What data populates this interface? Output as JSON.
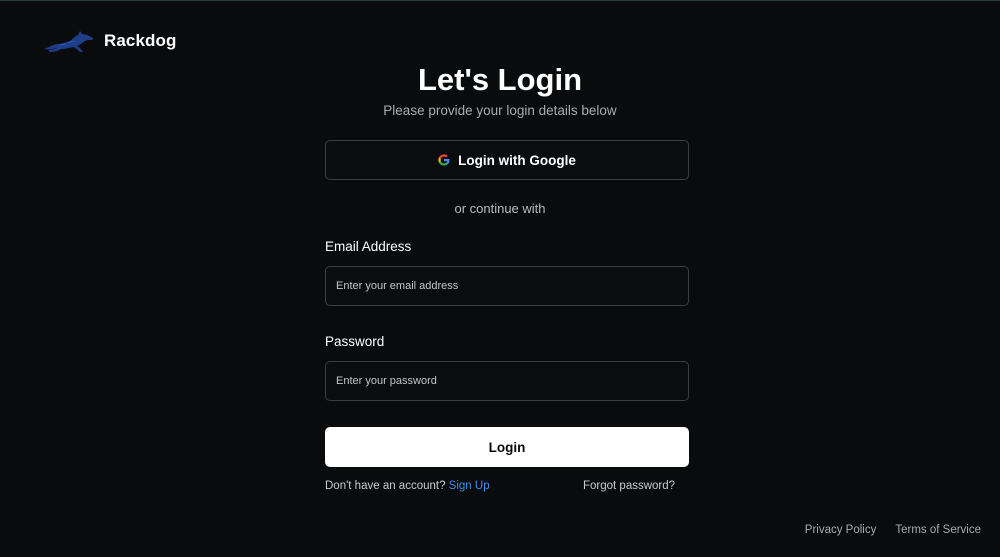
{
  "brand": {
    "name": "Rackdog",
    "logo_icon": "running-dog-icon",
    "logo_color": "#1f3e8a"
  },
  "login": {
    "title": "Let's Login",
    "subtitle": "Please provide your login details below",
    "google_button_label": "Login with Google",
    "google_icon": "google-icon",
    "divider_text": "or continue with",
    "email_label": "Email Address",
    "email_placeholder": "Enter your email address",
    "email_value": "",
    "password_label": "Password",
    "password_placeholder": "Enter your password",
    "password_value": "",
    "submit_label": "Login",
    "signup_prompt": "Don't have an account?",
    "signup_link": "Sign Up",
    "forgot_link": "Forgot password?"
  },
  "footer": {
    "privacy": "Privacy Policy",
    "terms": "Terms of Service"
  },
  "colors": {
    "background": "#0a0b0c",
    "accent_link": "#3d8ff0",
    "primary_button": "#ffffff",
    "border": "#3a3d42"
  }
}
